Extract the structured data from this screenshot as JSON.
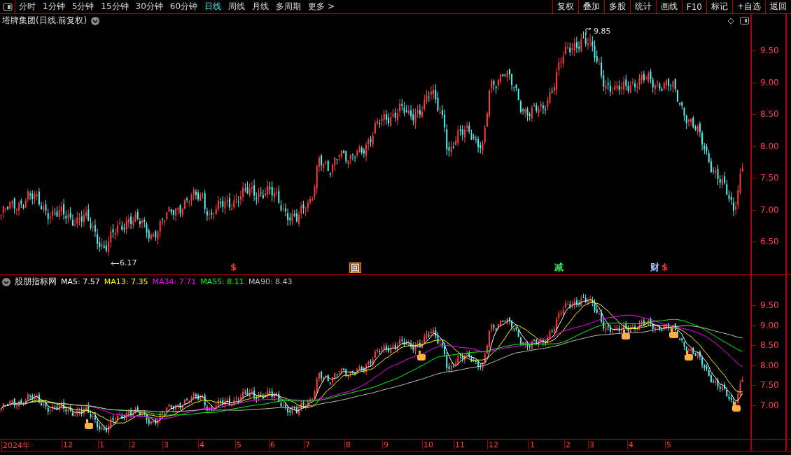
{
  "toolbar": {
    "periods": [
      {
        "label": "分时",
        "selected": false
      },
      {
        "label": "1分钟",
        "selected": false
      },
      {
        "label": "5分钟",
        "selected": false
      },
      {
        "label": "15分钟",
        "selected": false
      },
      {
        "label": "30分钟",
        "selected": false
      },
      {
        "label": "60分钟",
        "selected": false
      },
      {
        "label": "日线",
        "selected": true
      },
      {
        "label": "周线",
        "selected": false
      },
      {
        "label": "月线",
        "selected": false
      },
      {
        "label": "多周期",
        "selected": false
      },
      {
        "label": "更多 >",
        "selected": false
      }
    ],
    "actions": [
      "复权",
      "叠加",
      "多股",
      "统计",
      "画线",
      "F10",
      "标记",
      "+自选",
      "返回"
    ]
  },
  "price_chart": {
    "title": "塔牌集团(日线.前复权)",
    "price_axis": [
      "9.50",
      "9.00",
      "8.50",
      "8.00",
      "7.50",
      "7.00",
      "6.50"
    ],
    "annotations": [
      {
        "kind": "high",
        "label": "9.85"
      },
      {
        "kind": "low",
        "label": "6.17"
      }
    ],
    "markers": [
      {
        "kind": "text",
        "label": "$",
        "color": "#ff3030"
      },
      {
        "kind": "box",
        "label": "回",
        "color": "#ff9a20"
      },
      {
        "kind": "text",
        "label": "减",
        "color": "#30e060"
      },
      {
        "kind": "text",
        "label": "财",
        "color": "#a0c8ff"
      },
      {
        "kind": "text",
        "label": "$",
        "color": "#ff3030"
      }
    ]
  },
  "indicator": {
    "name": "股朋指标网",
    "legend": [
      {
        "label": "MA5: 7.57",
        "color": "#ffffff"
      },
      {
        "label": "MA13: 7.35",
        "color": "#ffff00"
      },
      {
        "label": "MA34: 7.71",
        "color": "#ff00ff"
      },
      {
        "label": "MA55: 8.11",
        "color": "#00ff00"
      },
      {
        "label": "MA90: 8.43",
        "color": "#c0c0c0"
      }
    ],
    "price_axis": [
      "9.50",
      "9.00",
      "8.50",
      "8.00",
      "7.50",
      "7.00"
    ]
  },
  "date_axis": [
    "2024年",
    "12",
    "1",
    "2",
    "3",
    "4",
    "5",
    "6",
    "7",
    "8",
    "9",
    "10",
    "11",
    "12",
    "1",
    "2",
    "3",
    "4",
    "5"
  ]
}
